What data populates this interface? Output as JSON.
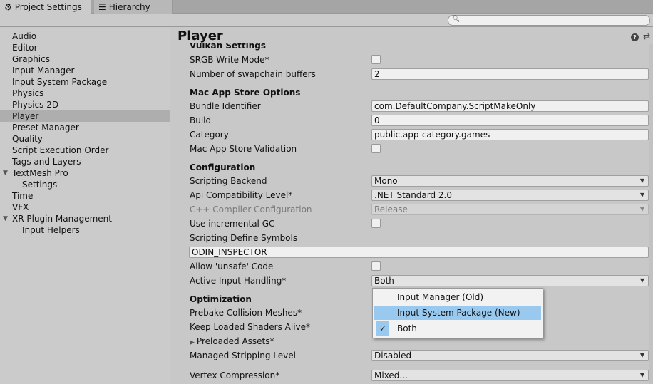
{
  "tabs": [
    {
      "label": "Project Settings",
      "icon": "gear-icon"
    },
    {
      "label": "Hierarchy",
      "icon": "list-icon"
    }
  ],
  "sidebar": {
    "items": [
      {
        "label": "Audio"
      },
      {
        "label": "Editor"
      },
      {
        "label": "Graphics"
      },
      {
        "label": "Input Manager"
      },
      {
        "label": "Input System Package"
      },
      {
        "label": "Physics"
      },
      {
        "label": "Physics 2D"
      },
      {
        "label": "Player",
        "selected": true
      },
      {
        "label": "Preset Manager"
      },
      {
        "label": "Quality"
      },
      {
        "label": "Script Execution Order"
      },
      {
        "label": "Tags and Layers"
      },
      {
        "label": "TextMesh Pro",
        "expanded": true
      },
      {
        "label": "Settings",
        "child": true
      },
      {
        "label": "Time"
      },
      {
        "label": "VFX"
      },
      {
        "label": "XR Plugin Management",
        "expanded": true
      },
      {
        "label": "Input Helpers",
        "child": true
      }
    ]
  },
  "main": {
    "title": "Player",
    "vulkan": {
      "header": "Vulkan Settings",
      "srgb_label": "SRGB Write Mode*",
      "swapchain_label": "Number of swapchain buffers",
      "swapchain_value": "2"
    },
    "mac": {
      "header": "Mac App Store Options",
      "bundle_label": "Bundle Identifier",
      "bundle_value": "com.DefaultCompany.ScriptMakeOnly",
      "build_label": "Build",
      "build_value": "0",
      "category_label": "Category",
      "category_value": "public.app-category.games",
      "validation_label": "Mac App Store Validation"
    },
    "config": {
      "header": "Configuration",
      "backend_label": "Scripting Backend",
      "backend_value": "Mono",
      "api_label": "Api Compatibility Level*",
      "api_value": ".NET Standard 2.0",
      "cpp_label": "C++ Compiler Configuration",
      "cpp_value": "Release",
      "incgc_label": "Use incremental GC",
      "define_label": "Scripting Define Symbols",
      "define_value": "ODIN_INSPECTOR",
      "unsafe_label": "Allow 'unsafe' Code",
      "input_label": "Active Input Handling*",
      "input_value": "Both"
    },
    "optim": {
      "header": "Optimization",
      "prebake_label": "Prebake Collision Meshes*",
      "shaders_label": "Keep Loaded Shaders Alive*",
      "preloaded_label": "Preloaded Assets*",
      "stripping_label": "Managed Stripping Level",
      "stripping_value": "Disabled",
      "vertex_label": "Vertex Compression*",
      "vertex_value": "Mixed..."
    }
  },
  "popup": {
    "items": [
      {
        "label": "Input Manager (Old)"
      },
      {
        "label": "Input System Package (New)",
        "highlighted": true
      },
      {
        "label": "Both",
        "checked": true
      }
    ]
  },
  "colors": {
    "selection": "#99c9ef",
    "sidebar_selected": "#aeaeae"
  }
}
